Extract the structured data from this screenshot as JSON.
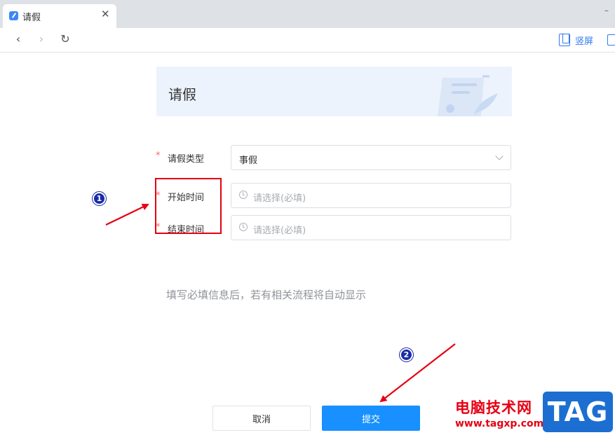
{
  "browser": {
    "tab_title": "请假",
    "tab_close": "✕",
    "minimize": "–",
    "nav_back": "‹",
    "nav_forward": "›",
    "nav_reload": "↻",
    "portrait_mode_label": "竖屏"
  },
  "form": {
    "title": "请假",
    "required_mark": "*",
    "fields": [
      {
        "label": "请假类型",
        "value": "事假",
        "type": "select"
      },
      {
        "label": "开始时间",
        "placeholder": "请选择(必填)",
        "type": "datetime"
      },
      {
        "label": "结束时间",
        "placeholder": "请选择(必填)",
        "type": "datetime"
      }
    ],
    "hint": "填写必填信息后，若有相关流程将自动显示",
    "cancel_label": "取消",
    "submit_label": "提交"
  },
  "annotations": {
    "badge_1": "1",
    "badge_2": "2",
    "highlight_color": "#e60012"
  },
  "watermark": {
    "text": "电脑技术网",
    "url": "www.tagxp.com",
    "tag": "TAG"
  },
  "colors": {
    "primary": "#1890ff",
    "required": "#f56c6c",
    "banner_bg": "#edf3fd"
  }
}
